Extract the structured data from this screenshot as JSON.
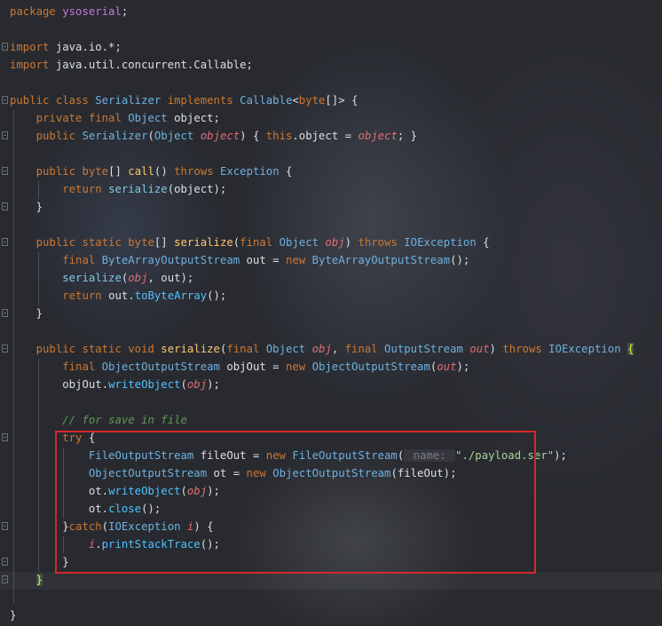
{
  "editor": {
    "lines": [
      [
        {
          "t": "package ",
          "c": "kw"
        },
        {
          "t": "ysoserial",
          "c": "pkg"
        },
        {
          "t": ";",
          "c": "plain"
        }
      ],
      [],
      [
        {
          "t": "import ",
          "c": "kw"
        },
        {
          "t": "java.io.*",
          "c": "plain"
        },
        {
          "t": ";",
          "c": "plain"
        }
      ],
      [
        {
          "t": "import ",
          "c": "kw"
        },
        {
          "t": "java.util.concurrent.Callable",
          "c": "plain"
        },
        {
          "t": ";",
          "c": "plain"
        }
      ],
      [],
      [
        {
          "t": "public class ",
          "c": "kw"
        },
        {
          "t": "Serializer ",
          "c": "cls"
        },
        {
          "t": "implements ",
          "c": "kw"
        },
        {
          "t": "Callable",
          "c": "cls"
        },
        {
          "t": "<",
          "c": "plain"
        },
        {
          "t": "byte",
          "c": "kw"
        },
        {
          "t": "[]> {",
          "c": "plain"
        }
      ],
      [
        {
          "t": "    "
        },
        {
          "t": "private final ",
          "c": "kw"
        },
        {
          "t": "Object ",
          "c": "cls"
        },
        {
          "t": "object",
          "c": "plain"
        },
        {
          "t": ";",
          "c": "plain"
        }
      ],
      [
        {
          "t": "    "
        },
        {
          "t": "public ",
          "c": "kw"
        },
        {
          "t": "Serializer",
          "c": "cls"
        },
        {
          "t": "(",
          "c": "plain"
        },
        {
          "t": "Object ",
          "c": "cls"
        },
        {
          "t": "object",
          "c": "param"
        },
        {
          "t": ") { ",
          "c": "plain"
        },
        {
          "t": "this",
          "c": "kw"
        },
        {
          "t": ".object = ",
          "c": "plain"
        },
        {
          "t": "object",
          "c": "param"
        },
        {
          "t": "; }",
          "c": "plain"
        }
      ],
      [],
      [
        {
          "t": "    "
        },
        {
          "t": "public ",
          "c": "kw"
        },
        {
          "t": "byte",
          "c": "kw"
        },
        {
          "t": "[] ",
          "c": "plain"
        },
        {
          "t": "call",
          "c": "fn"
        },
        {
          "t": "() ",
          "c": "plain"
        },
        {
          "t": "throws ",
          "c": "kw"
        },
        {
          "t": "Exception ",
          "c": "cls"
        },
        {
          "t": "{",
          "c": "plain"
        }
      ],
      [
        {
          "t": "        "
        },
        {
          "t": "return ",
          "c": "kw"
        },
        {
          "t": "serialize",
          "c": "call2"
        },
        {
          "t": "(object);",
          "c": "plain"
        }
      ],
      [
        {
          "t": "    "
        },
        {
          "t": "}",
          "c": "plain"
        }
      ],
      [],
      [
        {
          "t": "    "
        },
        {
          "t": "public static ",
          "c": "kw"
        },
        {
          "t": "byte",
          "c": "kw"
        },
        {
          "t": "[] ",
          "c": "plain"
        },
        {
          "t": "serialize",
          "c": "fn"
        },
        {
          "t": "(",
          "c": "plain"
        },
        {
          "t": "final ",
          "c": "kw"
        },
        {
          "t": "Object ",
          "c": "cls"
        },
        {
          "t": "obj",
          "c": "param"
        },
        {
          "t": ") ",
          "c": "plain"
        },
        {
          "t": "throws ",
          "c": "kw"
        },
        {
          "t": "IOException ",
          "c": "cls"
        },
        {
          "t": "{",
          "c": "plain"
        }
      ],
      [
        {
          "t": "        "
        },
        {
          "t": "final ",
          "c": "kw"
        },
        {
          "t": "ByteArrayOutputStream ",
          "c": "cls"
        },
        {
          "t": "out = ",
          "c": "plain"
        },
        {
          "t": "new ",
          "c": "kw"
        },
        {
          "t": "ByteArrayOutputStream",
          "c": "cls"
        },
        {
          "t": "();",
          "c": "plain"
        }
      ],
      [
        {
          "t": "        "
        },
        {
          "t": "serialize",
          "c": "call2"
        },
        {
          "t": "(",
          "c": "plain"
        },
        {
          "t": "obj",
          "c": "param"
        },
        {
          "t": ", out);",
          "c": "plain"
        }
      ],
      [
        {
          "t": "        "
        },
        {
          "t": "return ",
          "c": "kw"
        },
        {
          "t": "out.",
          "c": "plain"
        },
        {
          "t": "toByteArray",
          "c": "call"
        },
        {
          "t": "();",
          "c": "plain"
        }
      ],
      [
        {
          "t": "    "
        },
        {
          "t": "}",
          "c": "plain"
        }
      ],
      [],
      [
        {
          "t": "    "
        },
        {
          "t": "public static void ",
          "c": "kw"
        },
        {
          "t": "serialize",
          "c": "fn"
        },
        {
          "t": "(",
          "c": "plain"
        },
        {
          "t": "final ",
          "c": "kw"
        },
        {
          "t": "Object ",
          "c": "cls"
        },
        {
          "t": "obj",
          "c": "param"
        },
        {
          "t": ", ",
          "c": "plain"
        },
        {
          "t": "final ",
          "c": "kw"
        },
        {
          "t": "OutputStream ",
          "c": "cls"
        },
        {
          "t": "out",
          "c": "param"
        },
        {
          "t": ") ",
          "c": "plain"
        },
        {
          "t": "throws ",
          "c": "kw"
        },
        {
          "t": "IOException ",
          "c": "cls"
        },
        {
          "t": "{",
          "c": "brace-hl"
        }
      ],
      [
        {
          "t": "        "
        },
        {
          "t": "final ",
          "c": "kw"
        },
        {
          "t": "ObjectOutputStream ",
          "c": "cls"
        },
        {
          "t": "objOut = ",
          "c": "plain"
        },
        {
          "t": "new ",
          "c": "kw"
        },
        {
          "t": "ObjectOutputStream",
          "c": "cls"
        },
        {
          "t": "(",
          "c": "plain"
        },
        {
          "t": "out",
          "c": "param"
        },
        {
          "t": ");",
          "c": "plain"
        }
      ],
      [
        {
          "t": "        "
        },
        {
          "t": "objOut.",
          "c": "plain"
        },
        {
          "t": "writeObject",
          "c": "call"
        },
        {
          "t": "(",
          "c": "plain"
        },
        {
          "t": "obj",
          "c": "param"
        },
        {
          "t": ");",
          "c": "plain"
        }
      ],
      [],
      [
        {
          "t": "        "
        },
        {
          "t": "// for save in file",
          "c": "cmt"
        }
      ],
      [
        {
          "t": "        "
        },
        {
          "t": "try ",
          "c": "kw"
        },
        {
          "t": "{",
          "c": "plain"
        }
      ],
      [
        {
          "t": "            "
        },
        {
          "t": "FileOutputStream ",
          "c": "cls"
        },
        {
          "t": "fileOut = ",
          "c": "plain"
        },
        {
          "t": "new ",
          "c": "kw"
        },
        {
          "t": "FileOutputStream",
          "c": "cls"
        },
        {
          "t": "(",
          "c": "plain"
        },
        {
          "t": " name: ",
          "c": "hint"
        },
        {
          "t": "\"./payload.ser\"",
          "c": "strc"
        },
        {
          "t": ");",
          "c": "plain"
        }
      ],
      [
        {
          "t": "            "
        },
        {
          "t": "ObjectOutputStream ",
          "c": "cls"
        },
        {
          "t": "ot = ",
          "c": "plain"
        },
        {
          "t": "new ",
          "c": "kw"
        },
        {
          "t": "ObjectOutputStream",
          "c": "cls"
        },
        {
          "t": "(fileOut);",
          "c": "plain"
        }
      ],
      [
        {
          "t": "            "
        },
        {
          "t": "ot.",
          "c": "plain"
        },
        {
          "t": "writeObject",
          "c": "call"
        },
        {
          "t": "(",
          "c": "plain"
        },
        {
          "t": "obj",
          "c": "param"
        },
        {
          "t": ");",
          "c": "plain"
        }
      ],
      [
        {
          "t": "            "
        },
        {
          "t": "ot.",
          "c": "plain"
        },
        {
          "t": "close",
          "c": "call"
        },
        {
          "t": "();",
          "c": "plain"
        }
      ],
      [
        {
          "t": "        "
        },
        {
          "t": "}",
          "c": "plain"
        },
        {
          "t": "catch",
          "c": "kw"
        },
        {
          "t": "(",
          "c": "plain"
        },
        {
          "t": "IOException ",
          "c": "cls"
        },
        {
          "t": "i",
          "c": "param"
        },
        {
          "t": ") {",
          "c": "plain"
        }
      ],
      [
        {
          "t": "            "
        },
        {
          "t": "i",
          "c": "param"
        },
        {
          "t": ".",
          "c": "plain"
        },
        {
          "t": "printStackTrace",
          "c": "call"
        },
        {
          "t": "();",
          "c": "plain"
        }
      ],
      [
        {
          "t": "        "
        },
        {
          "t": "}",
          "c": "plain"
        }
      ],
      [
        {
          "t": "    "
        },
        {
          "t": "}",
          "c": "brace-hl"
        }
      ],
      [],
      [
        {
          "t": "}",
          "c": "plain"
        }
      ]
    ]
  },
  "highlight_box": {
    "color": "#d32a2a"
  }
}
